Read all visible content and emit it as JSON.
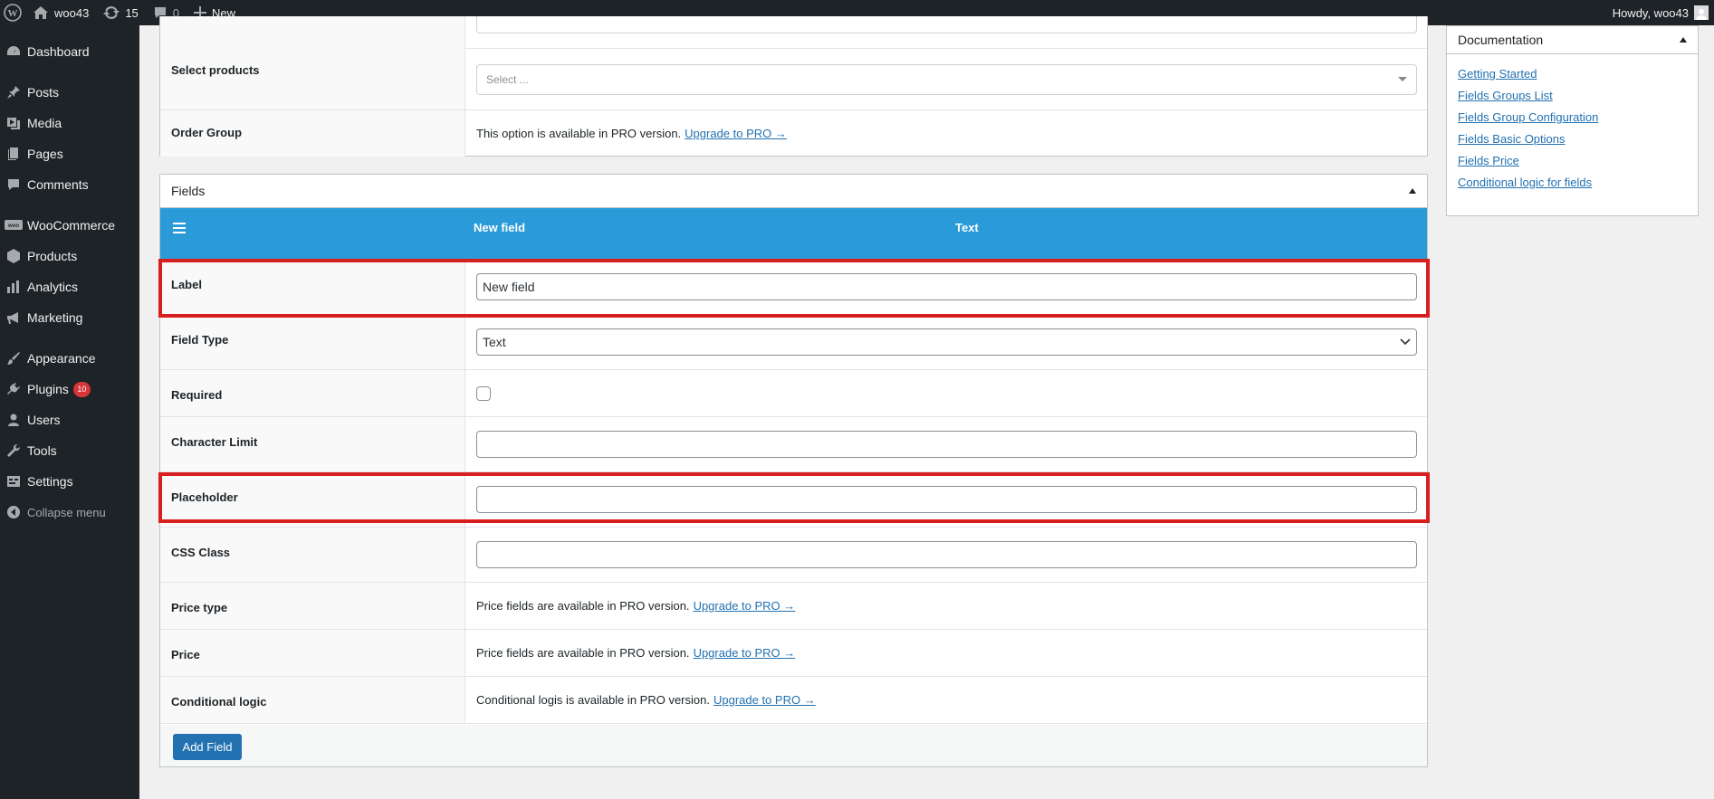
{
  "adminbar": {
    "site_name": "woo43",
    "updates_count": "15",
    "comments_count": "0",
    "new_label": "New",
    "howdy": "Howdy, woo43"
  },
  "sidebar": {
    "items": [
      {
        "label": "Dashboard",
        "icon": "dashboard-icon"
      },
      {
        "label": "Posts",
        "icon": "pin-icon"
      },
      {
        "label": "Media",
        "icon": "media-icon"
      },
      {
        "label": "Pages",
        "icon": "pages-icon"
      },
      {
        "label": "Comments",
        "icon": "comment-icon"
      },
      {
        "label": "WooCommerce",
        "icon": "woocommerce-icon"
      },
      {
        "label": "Products",
        "icon": "box-icon"
      },
      {
        "label": "Analytics",
        "icon": "bar-chart-icon"
      },
      {
        "label": "Marketing",
        "icon": "megaphone-icon"
      },
      {
        "label": "Appearance",
        "icon": "brush-icon"
      },
      {
        "label": "Plugins",
        "icon": "plug-icon",
        "badge": "10"
      },
      {
        "label": "Users",
        "icon": "user-icon"
      },
      {
        "label": "Tools",
        "icon": "wrench-icon"
      },
      {
        "label": "Settings",
        "icon": "settings-icon"
      },
      {
        "label": "Collapse menu",
        "icon": "collapse-icon"
      }
    ]
  },
  "top_panel": {
    "select_products_label": "Select products",
    "select_products_placeholder": "Select ...",
    "order_group_label": "Order Group",
    "order_group_text": "This option is available in PRO version.",
    "upgrade_link": "Upgrade to PRO →"
  },
  "fields_panel": {
    "title": "Fields",
    "bar_name": "New field",
    "bar_type": "Text",
    "rows": {
      "label": {
        "label": "Label",
        "value": "New field"
      },
      "field_type": {
        "label": "Field Type",
        "value": "Text"
      },
      "required": {
        "label": "Required"
      },
      "char_limit": {
        "label": "Character Limit",
        "value": ""
      },
      "placeholder": {
        "label": "Placeholder",
        "value": ""
      },
      "css_class": {
        "label": "CSS Class",
        "value": ""
      },
      "price_type": {
        "label": "Price type",
        "text": "Price fields are available in PRO version.",
        "link": "Upgrade to PRO →"
      },
      "price": {
        "label": "Price",
        "text": "Price fields are available in PRO version.",
        "link": "Upgrade to PRO →"
      },
      "conditional": {
        "label": "Conditional logic",
        "text": "Conditional logis is available in PRO version.",
        "link": "Upgrade to PRO →"
      }
    },
    "add_field_label": "Add Field"
  },
  "documentation": {
    "title": "Documentation",
    "links": [
      "Getting Started",
      "Fields Groups List",
      "Fields Group Configuration",
      "Fields Basic Options",
      "Fields Price",
      "Conditional logic for fields"
    ]
  },
  "colors": {
    "admin_dark": "#1d2327",
    "accent_blue": "#2a9bd8",
    "link_blue": "#2271b1",
    "highlight_red": "#d81e1e",
    "badge_red": "#d63638"
  }
}
